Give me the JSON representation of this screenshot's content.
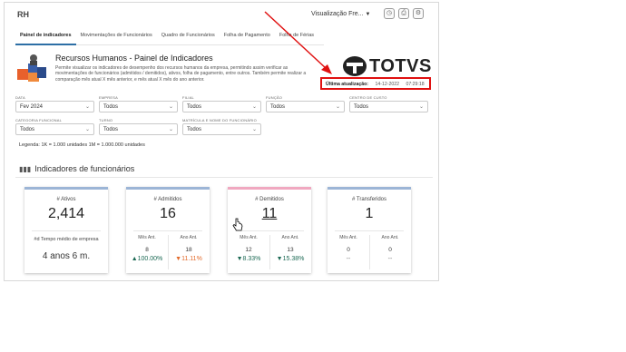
{
  "app": {
    "title": "RH",
    "view_select": "Visualização Fre..."
  },
  "top_icons": [
    "clock-icon",
    "print-icon",
    "gear-icon"
  ],
  "tabs": [
    {
      "label": "Painel de indicadores",
      "active": true
    },
    {
      "label": "Movimentações de Funcionários",
      "active": false
    },
    {
      "label": "Quadro de Funcionários",
      "active": false
    },
    {
      "label": "Folha de Pagamento",
      "active": false
    },
    {
      "label": "Folha de Férias",
      "active": false
    }
  ],
  "hero": {
    "title": "Recursos Humanos - Painel de Indicadores",
    "description": "Permite visualizar os indicadores de desempenho dos recursos humanos da empresa, permitindo assim verificar as movimentações de funcionários (admitidos / demitidos), ativos, folha de pagamento, entre outros. Também permite realizar a comparação mês atual X mês anterior, e mês atual X mês do ano anterior."
  },
  "logo": {
    "text": "TOTVS"
  },
  "update": {
    "label": "Última atualização:",
    "date": "14-12-2022",
    "time": "07:29:18"
  },
  "filters": {
    "row1": [
      {
        "label": "DATA",
        "value": "Fev 2024"
      },
      {
        "label": "EMPRESA",
        "value": "Todos"
      },
      {
        "label": "FILIAL",
        "value": "Todos"
      },
      {
        "label": "FUNÇÃO",
        "value": "Todos"
      },
      {
        "label": "CENTRO DE CUSTO",
        "value": "Todos"
      }
    ],
    "row2": [
      {
        "label": "CATEGORIA FUNCIONAL",
        "value": "Todos"
      },
      {
        "label": "TURNO",
        "value": "Todos"
      },
      {
        "label": "MATRÍCULA E NOME DO FUNCIONÁRIO",
        "value": "Todos"
      }
    ],
    "legend": "Legenda: 1K = 1.000 unidades 1M = 1.000.000 unidades"
  },
  "section": {
    "title": "Indicadores de funcionários"
  },
  "cards": {
    "ativos": {
      "title": "# Ativos",
      "value": "2,414",
      "extra_label": "#d Tempo médio de empresa",
      "extra_value": "4 anos 6 m."
    },
    "admitidos": {
      "title": "# Admitidos",
      "value": "16",
      "mes_label": "Mês Ant.",
      "ano_label": "Ano Ant.",
      "mes_value": "8",
      "ano_value": "18",
      "mes_pct": "▲100.00%",
      "ano_pct": "▼11.11%"
    },
    "demitidos": {
      "title": "# Demitidos",
      "value": "11",
      "mes_label": "Mês Ant.",
      "ano_label": "Ano Ant.",
      "mes_value": "12",
      "ano_value": "13",
      "mes_pct": "▼8.33%",
      "ano_pct": "▼15.38%"
    },
    "transferidos": {
      "title": "# Transferidos",
      "value": "1",
      "mes_label": "Mês Ant.",
      "ano_label": "Ano Ant.",
      "mes_value": "0",
      "ano_value": "0",
      "mes_pct": "--",
      "ano_pct": "--"
    }
  },
  "colors": {
    "annotation_red": "#e01010",
    "tab_active": "#2d6fa5",
    "up_green": "#1d6a55",
    "down_orange": "#e36b2c"
  }
}
